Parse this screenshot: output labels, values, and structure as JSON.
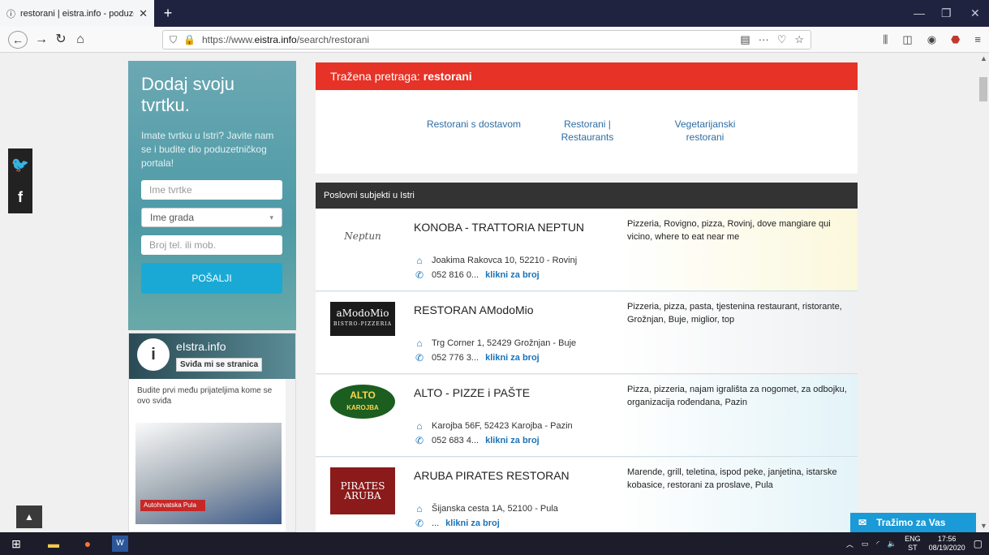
{
  "browser": {
    "tab_title": "restorani | eistra.info - poduze",
    "tab_close": "✕",
    "new_tab": "+",
    "url_prefix": "https://www.",
    "url_domain": "eistra.info",
    "url_path": "/search/restorani",
    "win_min": "—",
    "win_max": "❐",
    "win_close": "✕"
  },
  "social": {
    "twitter": "🐦",
    "facebook": "f"
  },
  "promo": {
    "title": "Dodaj svoju tvrtku.",
    "text": "Imate tvrtku u Istri? Javite nam se i budite dio poduzetničkog portala!",
    "company_placeholder": "Ime tvrtke",
    "city_placeholder": "Ime grada",
    "phone_placeholder": "Broj tel. ili mob.",
    "submit_label": "POŠALJI"
  },
  "fb": {
    "page_name": "eIstra.info",
    "like_label": "Sviđa mi se stranica",
    "message": "Budite prvi među prijateljima kome se ovo sviđa",
    "ad_label": "Autohrvatska Pula"
  },
  "search": {
    "label": "Tražena pretraga:",
    "query": "restorani"
  },
  "suggestions": [
    {
      "line1": "Restorani s dostavom",
      "line2": ""
    },
    {
      "line1": "Restorani |",
      "line2": "Restaurants"
    },
    {
      "line1": "Vegetarijanski",
      "line2": "restorani"
    }
  ],
  "list_header": "Poslovni subjekti u Istri",
  "businesses": [
    {
      "logo_text": "Neptun",
      "name": "KONOBA - TRATTORIA NEPTUN",
      "address": "Joakima Rakovca 10, 52210 - Rovinj",
      "phone": "052 816 0...",
      "phone_link": "klikni za broj",
      "tags": "Pizzeria, Rovigno, pizza, Rovinj, dove mangiare qui vicino, where to eat near me",
      "tint": "#fbf8dc"
    },
    {
      "logo_text": "aModoMio",
      "logo_sub": "BISTRO-PIZZERIA",
      "name": "RESTORAN AModoMio",
      "address": "Trg Corner 1, 52429 Grožnjan - Buje",
      "phone": "052 776 3...",
      "phone_link": "klikni za broj",
      "tags": "Pizzeria, pizza, pasta, tjestenina restaurant, ristorante, Grožnjan, Buje, miglior, top",
      "tint": "#eef0f2"
    },
    {
      "logo_text": "ALTO",
      "logo_sub": "KAROJBA",
      "name": "ALTO - PIZZE i PAŠTE",
      "address": "Karojba 56F, 52423 Karojba - Pazin",
      "phone": "052 683 4...",
      "phone_link": "klikni za broj",
      "tags": "Pizza, pizzeria, najam igrališta za nogomet, za odbojku, organizacija rođendana, Pazin",
      "tint": "#e3f3f8"
    },
    {
      "logo_text": "PIRATES",
      "logo_sub": "ARUBA",
      "name": "ARUBA PIRATES RESTORAN",
      "address": "Šijanska cesta 1A, 52100 - Pula",
      "phone": "...",
      "phone_link": "klikni za broj",
      "tags": "Marende, grill, teletina, ispod peke, janjetina, istarske kobasice, restorani za proslave, Pula",
      "tint": "#e4f4f8"
    }
  ],
  "chat_label": "Tražimo za Vas",
  "taskbar": {
    "lang1": "ENG",
    "lang2": "ST",
    "time": "17:56",
    "date": "08/19/2020"
  }
}
